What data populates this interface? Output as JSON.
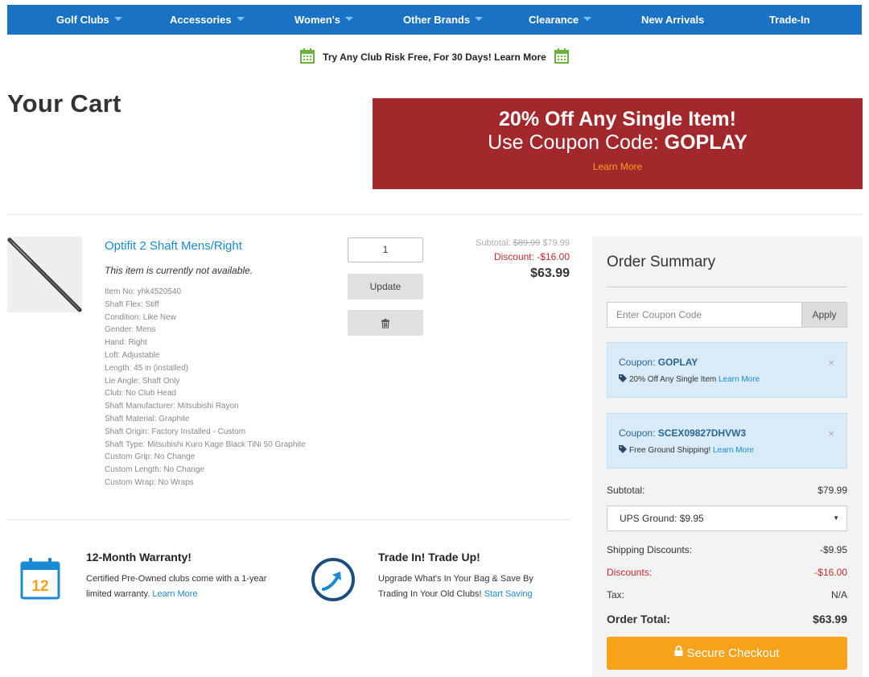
{
  "nav": {
    "items": [
      {
        "label": "Golf Clubs",
        "dropdown": true
      },
      {
        "label": "Accessories",
        "dropdown": true
      },
      {
        "label": "Women's",
        "dropdown": true
      },
      {
        "label": "Other Brands",
        "dropdown": true
      },
      {
        "label": "Clearance",
        "dropdown": true
      },
      {
        "label": "New Arrivals",
        "dropdown": false
      },
      {
        "label": "Trade-In",
        "dropdown": false
      }
    ]
  },
  "promo_strip": {
    "text": "Try Any Club Risk Free, For 30 Days! Learn More"
  },
  "page_title": "Your Cart",
  "banner": {
    "line1": "20% Off Any Single Item!",
    "line2_prefix": "Use Coupon Code: ",
    "line2_code": "GOPLAY",
    "link": "Learn More"
  },
  "cart_item": {
    "title": "Optifit 2 Shaft Mens/Right",
    "availability": "This item is currently not available.",
    "specs": [
      "Item No: yhk4520540",
      "Shaft Flex: Stiff",
      "Condition: Like New",
      "Gender: Mens",
      "Hand: Right",
      "Loft: Adjustable",
      "Length: 45 in (installed)",
      "Lie Angle: Shaft Only",
      "Club: No Club Head",
      "Shaft Manufacturer: Mitsubishi Rayon",
      "Shaft Material: Graphite",
      "Shaft Origin: Factory Installed - Custom",
      "Shaft Type: Mitsubishi Kuro Kage Black TiNi 50 Graphite",
      "Custom Grip: No Change",
      "Custom Length: No Change",
      "Custom Wrap: No Wraps"
    ],
    "quantity": "1",
    "update_label": "Update",
    "subtotal_label": "Subtotal:",
    "original_price": "$89.99",
    "subtotal_price": "$79.99",
    "discount": "Discount: -$16.00",
    "final_price": "$63.99"
  },
  "features": {
    "warranty": {
      "icon_number": "12",
      "title": "12-Month Warranty!",
      "text": "Certified Pre-Owned clubs come with a 1-year limited warranty.",
      "link": "Learn More"
    },
    "trade": {
      "title": "Trade In! Trade Up!",
      "text": "Upgrade What's In Your Bag & Save By Trading In Your Old Clubs!",
      "link": "Start Saving"
    }
  },
  "summary": {
    "title": "Order Summary",
    "coupon_placeholder": "Enter Coupon Code",
    "apply_label": "Apply",
    "coupons": [
      {
        "label": "Coupon: ",
        "code": "GOPLAY",
        "desc": "20% Off Any Single Item",
        "link": "Learn More"
      },
      {
        "label": "Coupon: ",
        "code": "SCEX09827DHVW3",
        "desc": "Free Ground Shipping!",
        "link": "Learn More"
      }
    ],
    "close_glyph": "×",
    "subtotal_label": "Subtotal:",
    "subtotal_value": "$79.99",
    "shipping_option": "UPS Ground: $9.95",
    "shipping_discounts_label": "Shipping Discounts:",
    "shipping_discounts_value": "-$9.95",
    "discounts_label": "Discounts:",
    "discounts_value": "-$16.00",
    "tax_label": "Tax:",
    "tax_value": "N/A",
    "total_label": "Order Total:",
    "total_value": "$63.99",
    "checkout_label": "Secure Checkout"
  },
  "colors": {
    "nav_bg": "#1a72c4",
    "banner_bg": "#a3282b",
    "accent_orange": "#f7a21b",
    "link_blue": "#1a8ad4",
    "discount_red": "#c62b2b"
  }
}
